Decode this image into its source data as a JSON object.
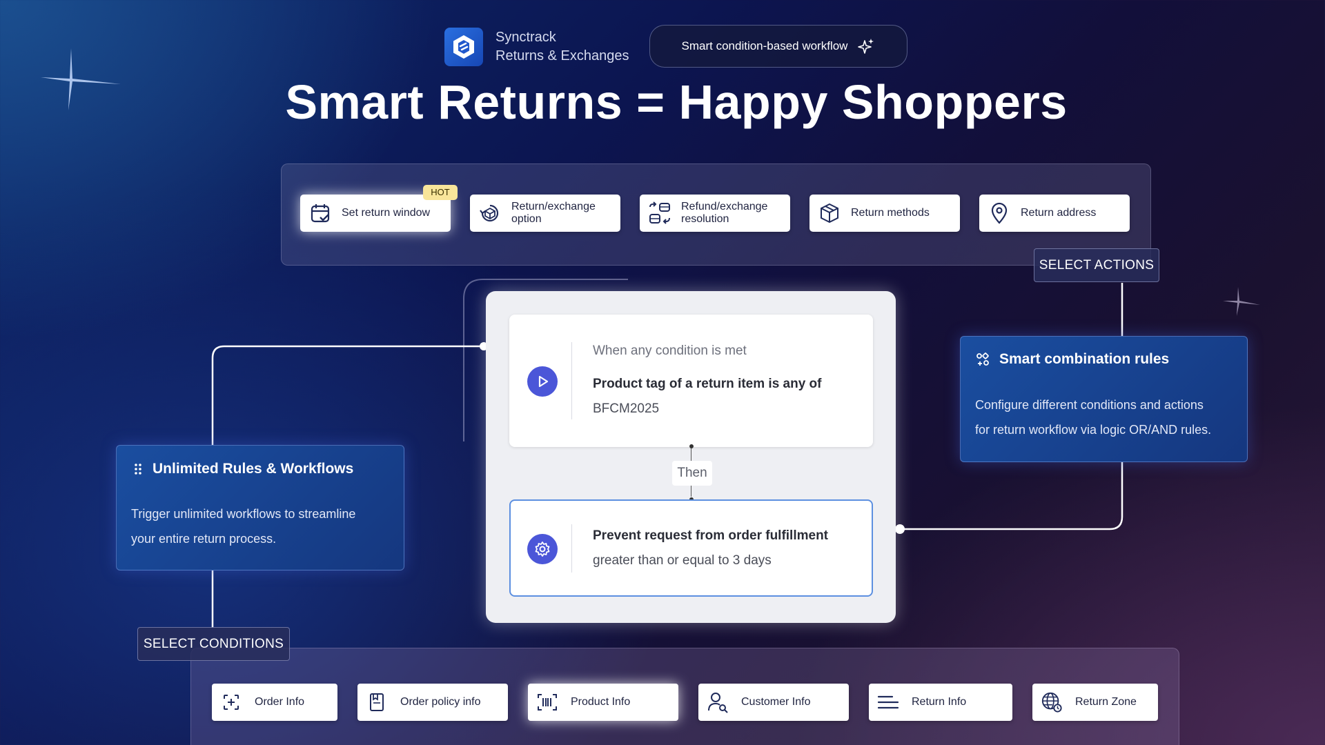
{
  "brand": {
    "name": "Synctrack",
    "subtitle": "Returns & Exchanges",
    "logo_icon": "synctrack-logo"
  },
  "pill": {
    "label": "Smart condition-based workflow",
    "icon": "sparkle-icon"
  },
  "title": "Smart Returns = Happy Shoppers",
  "actions": {
    "label": "SELECT ACTIONS",
    "badge": "HOT",
    "items": [
      {
        "label": "Set return window",
        "icon": "calendar-check-icon"
      },
      {
        "label": "Return/exchange option",
        "icon": "box-cycle-icon"
      },
      {
        "label": "Refund/exchange resolution",
        "icon": "resolution-icon"
      },
      {
        "label": "Return methods",
        "icon": "package-icon"
      },
      {
        "label": "Return address",
        "icon": "location-pin-icon"
      }
    ]
  },
  "workflow": {
    "condition_header": "When any condition is met",
    "condition_bold": "Product tag of a return item is any of",
    "condition_value": "BFCM2025",
    "then_label": "Then",
    "action_bold": "Prevent request from order fulfillment",
    "action_detail": "greater than or equal to 3 days"
  },
  "smart_rules": {
    "title": "Smart combination rules",
    "body_line1": "Configure different conditions and actions",
    "body_line2": "for return workflow via logic OR/AND rules."
  },
  "unlimited": {
    "title": "Unlimited Rules & Workflows",
    "body_line1": "Trigger unlimited workflows to streamline",
    "body_line2": "your entire return process."
  },
  "conditions": {
    "label": "SELECT CONDITIONS",
    "items": [
      {
        "label": "Order Info",
        "icon": "order-add-icon"
      },
      {
        "label": "Order policy info",
        "icon": "policy-icon"
      },
      {
        "label": "Product Info",
        "icon": "barcode-icon"
      },
      {
        "label": "Customer Info",
        "icon": "customer-icon"
      },
      {
        "label": "Return Info",
        "icon": "list-lines-icon"
      },
      {
        "label": "Return Zone",
        "icon": "globe-icon"
      }
    ]
  },
  "colors": {
    "accent": "#4b56d8",
    "card_blue": "#1a4ea0",
    "hot_badge": "#f8e59a",
    "action_border": "#5c8fe0"
  }
}
